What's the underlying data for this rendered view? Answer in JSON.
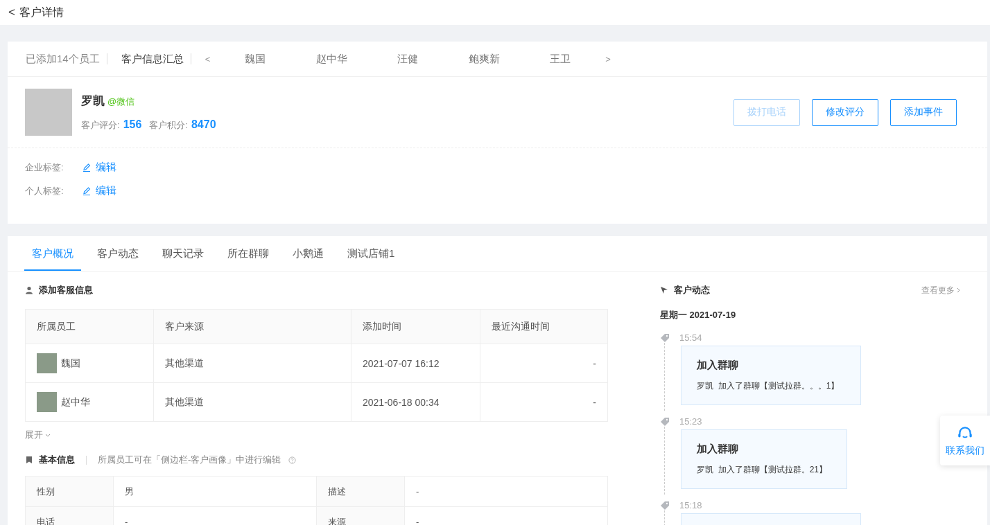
{
  "header": {
    "back": "<",
    "title": "客户详情"
  },
  "staff_strip": {
    "count": "已添加14个员工",
    "summary": "客户信息汇总",
    "prev": "<",
    "next": ">",
    "names": [
      "魏国",
      "赵中华",
      "汪健",
      "鲍爽新",
      "王卫"
    ]
  },
  "profile": {
    "name": "罗凯",
    "channel": "@微信",
    "score_label": "客户评分:",
    "score": "156",
    "points_label": "客户积分:",
    "points": "8470"
  },
  "actions": [
    {
      "label": "拨打电话",
      "disabled": true
    },
    {
      "label": "修改评分",
      "disabled": false
    },
    {
      "label": "添加事件",
      "disabled": false
    }
  ],
  "tag_rows": [
    {
      "label": "企业标签:",
      "action": "编辑"
    },
    {
      "label": "个人标签:",
      "action": "编辑"
    }
  ],
  "tabs": [
    {
      "label": "客户概况",
      "selected": true
    },
    {
      "label": "客户动态",
      "selected": false
    },
    {
      "label": "聊天记录",
      "selected": false
    },
    {
      "label": "所在群聊",
      "selected": false
    },
    {
      "label": "小鹅通",
      "selected": false
    },
    {
      "label": "测试店铺1",
      "selected": false
    }
  ],
  "service_info": {
    "title": "添加客服信息",
    "columns": [
      "所属员工",
      "客户来源",
      "添加时间",
      "最近沟通时间"
    ],
    "rows": [
      {
        "staff": "魏国",
        "source": "其他渠道",
        "added": "2021-07-07 16:12",
        "last_contact": "-"
      },
      {
        "staff": "赵中华",
        "source": "其他渠道",
        "added": "2021-06-18 00:34",
        "last_contact": "-"
      }
    ],
    "expand": "展开"
  },
  "basic_info": {
    "title": "基本信息",
    "hint": "所属员工可在「侧边栏-客户画像」中进行编辑",
    "rows": [
      [
        "性别",
        "男",
        "描述",
        "-"
      ],
      [
        "电话",
        "-",
        "来源",
        "-"
      ]
    ]
  },
  "activity": {
    "title": "客户动态",
    "more": "查看更多",
    "date": "星期一 2021-07-19",
    "entries": [
      {
        "time": "15:54",
        "title": "加入群聊",
        "text": "罗凯  加入了群聊【测试拉群。。。1】"
      },
      {
        "time": "15:23",
        "title": "加入群聊",
        "text": "罗凯  加入了群聊【测试拉群。21】"
      },
      {
        "time": "15:18"
      }
    ]
  },
  "contact": {
    "label": "联系我们"
  }
}
